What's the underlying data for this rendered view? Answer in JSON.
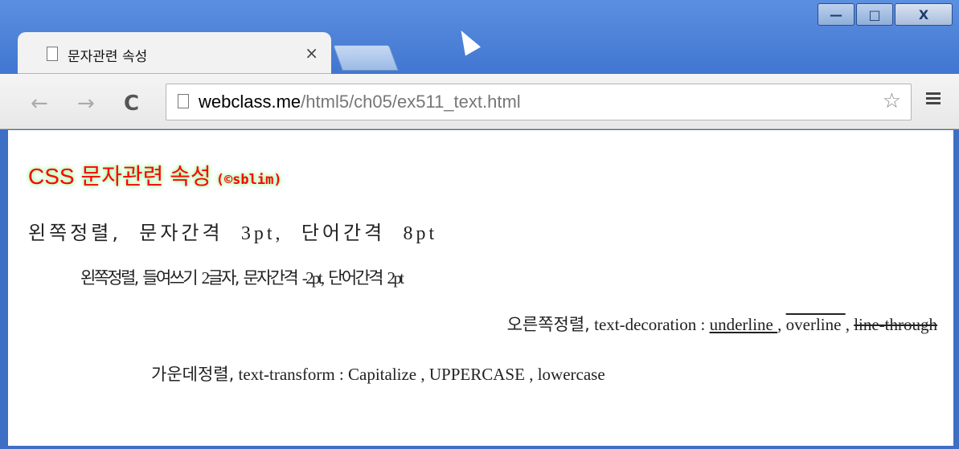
{
  "browser": {
    "tab_title": "문자관련 속성",
    "tab_close": "×",
    "url_host": "webclass.me",
    "url_path": "/html5/ch05/ex511_text.html",
    "window_controls": {
      "minimize": "—",
      "maximize": "□",
      "close": "X"
    }
  },
  "page": {
    "heading": "CSS 문자관련 속성",
    "heading_author": "(©sblim)",
    "line1_ko1": "왼쪽정렬,",
    "line1_ko2": "문자간격",
    "line1_en1": "3pt,",
    "line1_ko3": "단어간격",
    "line1_en2": "8pt",
    "line2_ko1": "왼쪽정렬, 들여쓰기",
    "line2_en1": "2",
    "line2_ko2": "글자, 문자간격",
    "line2_en2": "-2pt,",
    "line2_ko3": "단어간격",
    "line2_en3": "2pt",
    "line3_ko": "오른쪽정렬,",
    "line3_label": " text-decoration : ",
    "line3_underline": "underline ",
    "line3_sep1": ", ",
    "line3_overline": "overline ",
    "line3_sep2": ", ",
    "line3_linethrough": "line-through",
    "line4_ko": "가운데정렬,",
    "line4_label": " text-transform : ",
    "line4_capitalize": "Capitalize",
    "line4_sep1": " , ",
    "line4_uppercase": "UPPERCASE",
    "line4_sep2": " , ",
    "line4_lowercase": "lowercase"
  }
}
